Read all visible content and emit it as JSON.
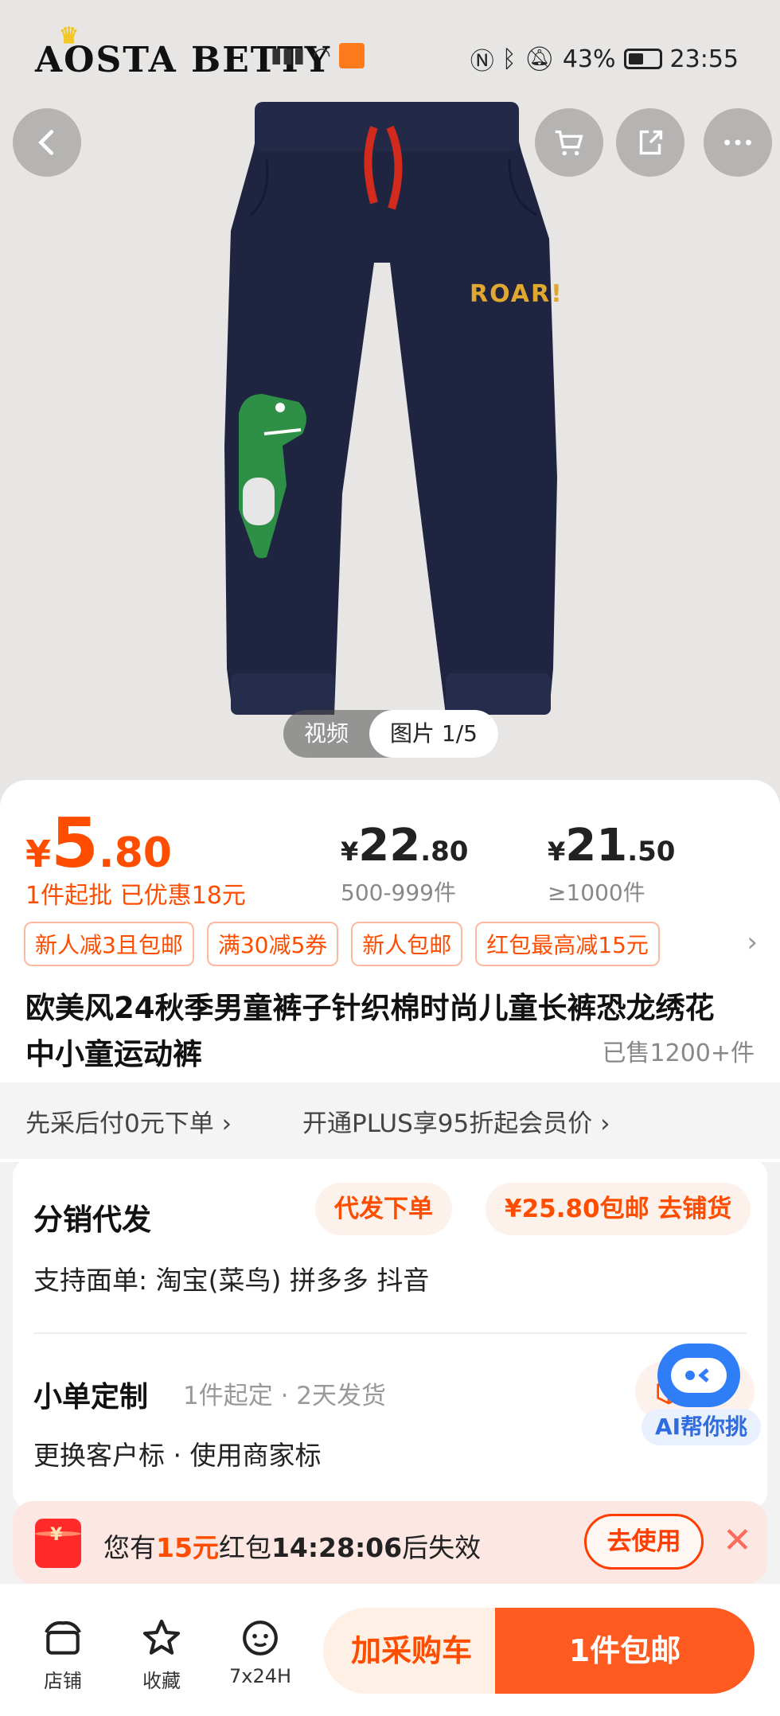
{
  "status_bar": {
    "battery": "43%",
    "time": "23:55"
  },
  "brand": {
    "logo_text": "AOSTA BETTY"
  },
  "gallery": {
    "video_tab": "视频",
    "image_tab": "图片 1/5"
  },
  "product_print": {
    "text": "ROAR!"
  },
  "price": {
    "main": {
      "yen": "¥",
      "int": "5",
      "dec": ".80"
    },
    "main_note": "1件起批   已优惠18元",
    "tiers": [
      {
        "yen": "¥",
        "int": "22",
        "dec": ".80",
        "range": "500-999件"
      },
      {
        "yen": "¥",
        "int": "21",
        "dec": ".50",
        "range": "≥1000件"
      }
    ]
  },
  "coupons": [
    "新人减3且包邮",
    "满30减5券",
    "新人包邮",
    "红包最高减15元"
  ],
  "coupons_more": "›",
  "title": "欧美风24秋季男童裤子针织棉时尚儿童长裤恐龙绣花中小童运动裤",
  "sold": "已售1200+件",
  "links": {
    "pay_later": "先采后付0元下单 ›",
    "plus": "开通PLUS享95折起会员价 ›"
  },
  "distribution": {
    "title": "分销代发",
    "dropship_btn": "代发下单",
    "shop_btn": "¥25.80包邮 去铺货",
    "support": "支持面单:  淘宝(菜鸟) 拼多多 抖音"
  },
  "custom": {
    "title": "小单定制",
    "meta": "1件起定  ·  2天发货",
    "sub": "更换客户标  ·  使用商家标",
    "pill": "去"
  },
  "ai": {
    "label": "AI帮你挑"
  },
  "redpack": {
    "yen": "¥",
    "prefix": "您有",
    "amount": "15元",
    "middle": "红包",
    "countdown": "14:28:06",
    "suffix": "后失效",
    "use_btn": "去使用",
    "close": "✕"
  },
  "bottom": {
    "tabs": [
      {
        "label": "店铺",
        "icon": "shop-icon"
      },
      {
        "label": "收藏",
        "icon": "star-icon"
      },
      {
        "label": "7x24H",
        "icon": "service-icon"
      }
    ],
    "cart_btn": "加采购车",
    "buy_btn": "1件包邮"
  },
  "colors": {
    "accent": "#ff4d00",
    "buy": "#ff5a1f",
    "ai": "#2f7ef7"
  }
}
